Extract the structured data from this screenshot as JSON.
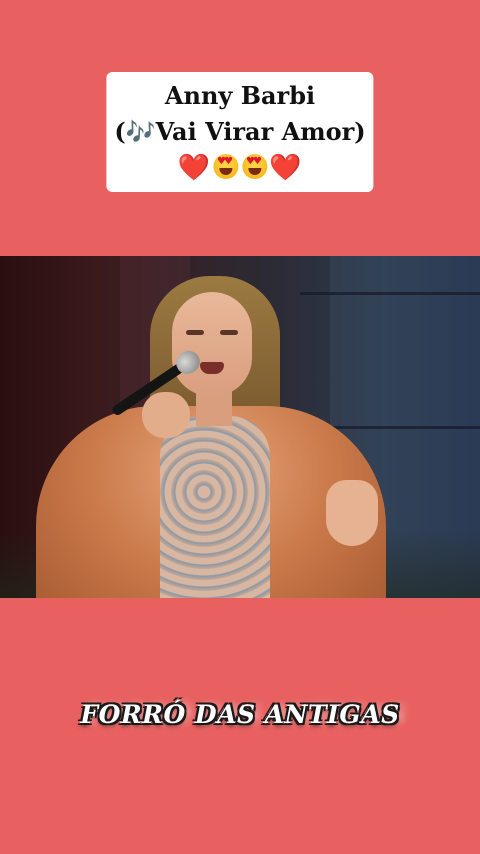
{
  "caption": {
    "line1": "Anny Barbi",
    "line2_open": "(",
    "music_note": "🎶",
    "line2_rest": "Vai Virar Amor)",
    "emoji_line": {
      "heart_left": "❤️",
      "heart_right": "❤️",
      "icons": [
        "red-heart",
        "heart-eyes-smiley",
        "heart-eyes-smiley",
        "red-heart"
      ]
    }
  },
  "video": {
    "description_icon": "singer-with-microphone"
  },
  "bottom_label": "FORRÓ DAS ANTIGAS",
  "colors": {
    "background": "#e8605f",
    "caption_bg": "#ffffff",
    "heart": "#e0162b",
    "label_text": "#ffffff"
  }
}
